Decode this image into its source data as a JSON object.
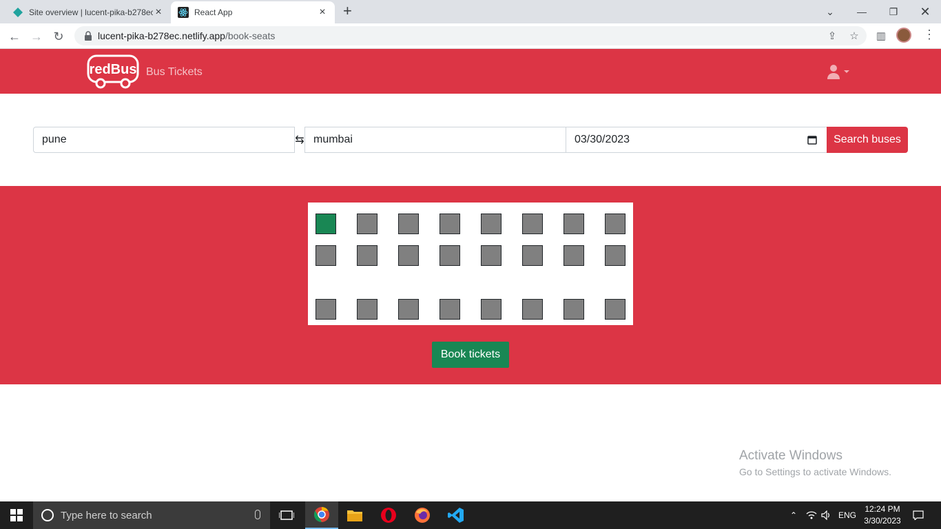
{
  "browser": {
    "tabs": [
      {
        "title": "Site overview | lucent-pika-b278ec",
        "icon": "netlify-icon"
      },
      {
        "title": "React App",
        "icon": "react-icon"
      }
    ],
    "url_domain": "lucent-pika-b278ec.netlify.app",
    "url_path": "/book-seats"
  },
  "header": {
    "logo_text": "redBus",
    "brand_label": "Bus Tickets"
  },
  "search": {
    "from": "pune",
    "to": "mumbai",
    "date": "03/30/2023",
    "swap_symbol": "⇆",
    "button_label": "Search buses"
  },
  "seats": {
    "rows": [
      [
        "selected",
        "available",
        "available",
        "available",
        "available",
        "available",
        "available",
        "available"
      ],
      [
        "available",
        "available",
        "available",
        "available",
        "available",
        "available",
        "available",
        "available"
      ],
      [
        "available",
        "available",
        "available",
        "available",
        "available",
        "available",
        "available",
        "available"
      ]
    ],
    "selected_color": "#198754",
    "available_color": "#808080"
  },
  "book_button_label": "Book tickets",
  "watermark": {
    "line1": "Activate Windows",
    "line2": "Go to Settings to activate Windows."
  },
  "taskbar": {
    "search_placeholder": "Type here to search",
    "language": "ENG",
    "time": "12:24 PM",
    "date": "3/30/2023"
  },
  "colors": {
    "brand_red": "#dc3545",
    "success_green": "#198754"
  }
}
